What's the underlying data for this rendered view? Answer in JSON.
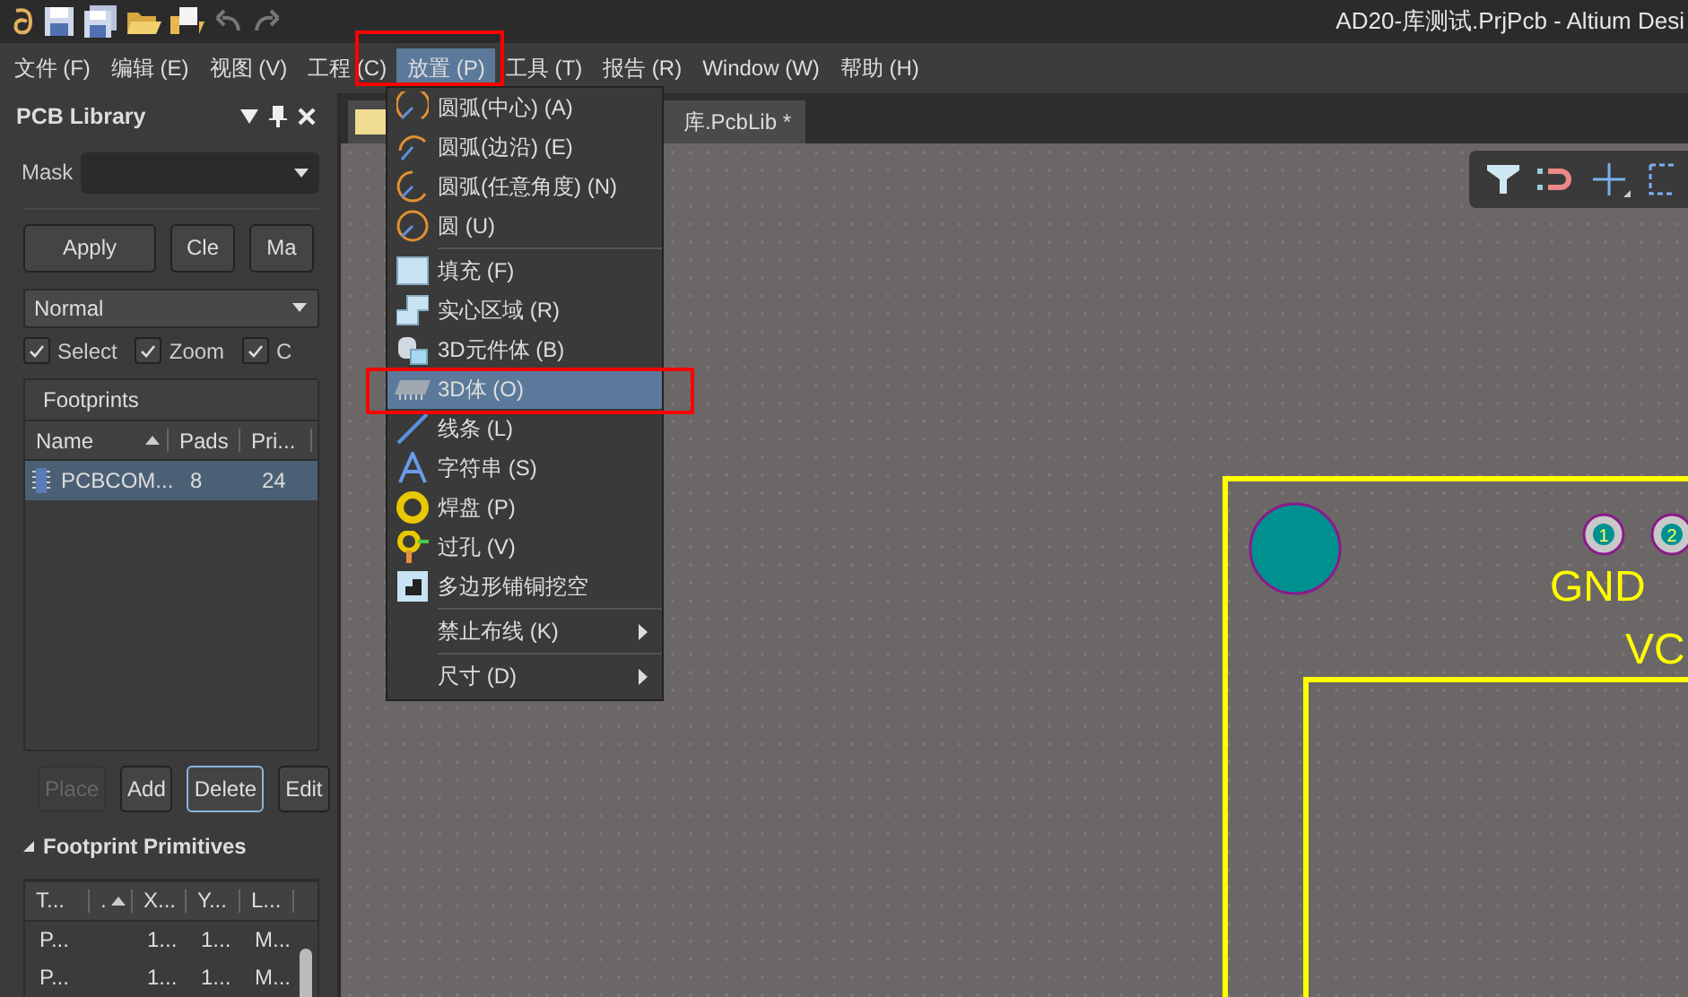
{
  "window": {
    "title": "AD20-库测试.PrjPcb - Altium Desi"
  },
  "menu_bar": [
    {
      "label": "文件 (F)",
      "selected": false
    },
    {
      "label": "编辑 (E)",
      "selected": false
    },
    {
      "label": "视图 (V)",
      "selected": false
    },
    {
      "label": "工程 (C)",
      "selected": false
    },
    {
      "label": "放置 (P)",
      "selected": true
    },
    {
      "label": "工具 (T)",
      "selected": false
    },
    {
      "label": "报告 (R)",
      "selected": false
    },
    {
      "label": "Window (W)",
      "selected": false
    },
    {
      "label": "帮助 (H)",
      "selected": false
    }
  ],
  "document_tab": {
    "label": "库.PcbLib *"
  },
  "panel": {
    "title": "PCB Library",
    "mask_label": "Mask",
    "filter_buttons": [
      {
        "label": "Apply"
      },
      {
        "label": "Cle"
      },
      {
        "label": "Ma"
      }
    ],
    "mode": "Normal",
    "checkboxes": [
      {
        "label": "Select",
        "checked": true
      },
      {
        "label": "Zoom",
        "checked": true
      },
      {
        "label": "C",
        "checked": true
      }
    ],
    "footprints": {
      "title": "Footprints",
      "columns": [
        {
          "label": "Name",
          "sorted": true
        },
        {
          "label": "Pads"
        },
        {
          "label": "Pri..."
        }
      ],
      "rows": [
        {
          "cells": [
            "PCBCOM...",
            "8",
            "24"
          ],
          "selected": true
        }
      ]
    },
    "actions": [
      {
        "label": "Place",
        "disabled": true,
        "focused": false
      },
      {
        "label": "Add",
        "disabled": false,
        "focused": false
      },
      {
        "label": "Delete",
        "disabled": false,
        "focused": true
      },
      {
        "label": "Edit",
        "disabled": false,
        "focused": false
      }
    ],
    "primitives": {
      "title": "Footprint Primitives",
      "expanded": true,
      "columns": [
        {
          "label": "T..."
        },
        {
          "label": ".",
          "sorted": true
        },
        {
          "label": "X..."
        },
        {
          "label": "Y..."
        },
        {
          "label": "L..."
        }
      ],
      "rows": [
        {
          "cells": [
            "P...",
            null,
            "1...",
            "1...",
            "M..."
          ]
        },
        {
          "cells": [
            "P...",
            null,
            "1...",
            "1...",
            "M..."
          ]
        }
      ]
    }
  },
  "place_menu": [
    {
      "kind": "item",
      "label": "圆弧(中心) (A)",
      "selected": false
    },
    {
      "kind": "item",
      "label": "圆弧(边沿) (E)",
      "selected": false
    },
    {
      "kind": "item",
      "label": "圆弧(任意角度) (N)",
      "selected": false
    },
    {
      "kind": "item",
      "label": "圆 (U)",
      "selected": false
    },
    {
      "kind": "separator"
    },
    {
      "kind": "item",
      "label": "填充 (F)",
      "selected": false
    },
    {
      "kind": "item",
      "label": "实心区域 (R)",
      "selected": false
    },
    {
      "kind": "item",
      "label": "3D元件体 (B)",
      "selected": false
    },
    {
      "kind": "item",
      "label": "3D体 (O)",
      "selected": true
    },
    {
      "kind": "item",
      "label": "线条 (L)",
      "selected": false
    },
    {
      "kind": "item",
      "label": "字符串 (S)",
      "selected": false
    },
    {
      "kind": "item",
      "label": "焊盘 (P)",
      "selected": false
    },
    {
      "kind": "item",
      "label": "过孔 (V)",
      "selected": false
    },
    {
      "kind": "item",
      "label": "多边形铺铜挖空",
      "selected": false
    },
    {
      "kind": "separator"
    },
    {
      "kind": "submenu",
      "label": "禁止布线 (K)",
      "selected": false
    },
    {
      "kind": "separator"
    },
    {
      "kind": "submenu",
      "label": "尺寸 (D)",
      "selected": false
    }
  ],
  "pcb": {
    "pads": [
      {
        "label": "1"
      },
      {
        "label": "2"
      }
    ],
    "labels": [
      "GND",
      "VC"
    ]
  }
}
